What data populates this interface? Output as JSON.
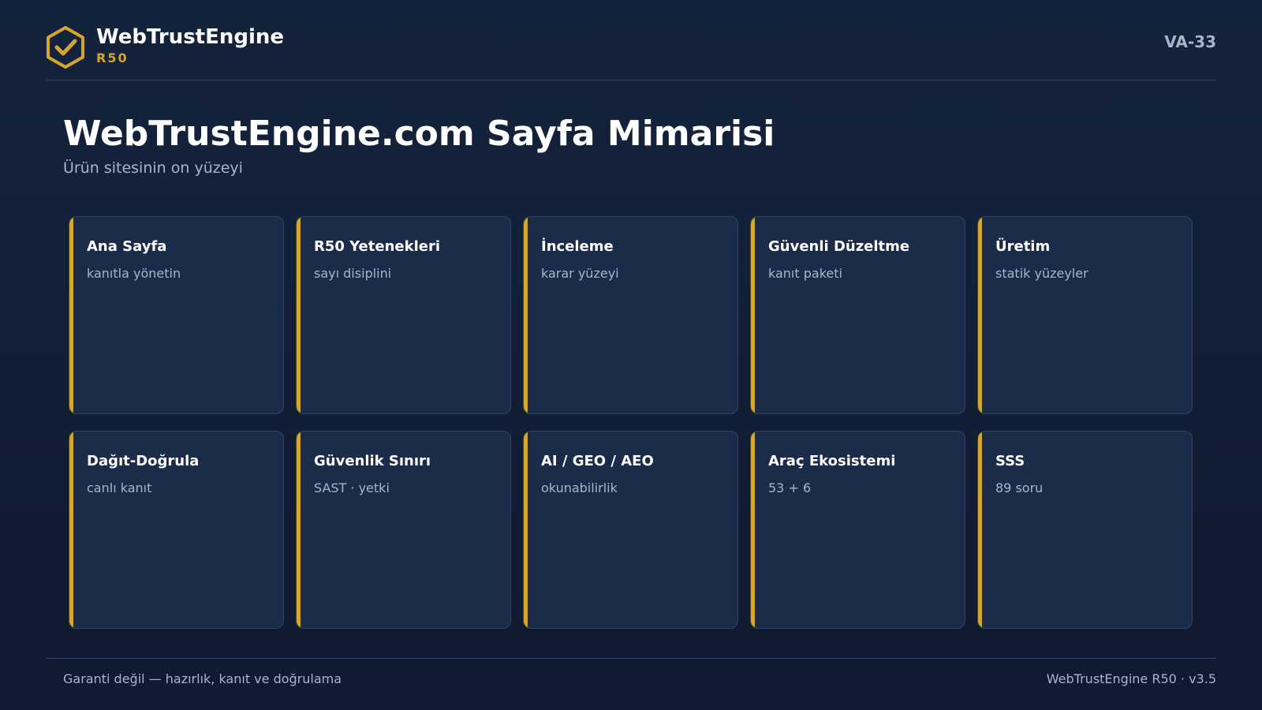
{
  "header": {
    "brand_name": "WebTrustEngine",
    "brand_sub": "R50",
    "doc_code": "VA-33",
    "logo_icon": "hexagon-check-icon",
    "accent_color": "#d4a72c"
  },
  "main": {
    "title": "WebTrustEngine.com Sayfa Mimarisi",
    "subtitle": "Ürün sitesinin on yüzeyi",
    "cards": [
      {
        "title": "Ana Sayfa",
        "desc": "kanıtla yönetin"
      },
      {
        "title": "R50 Yetenekleri",
        "desc": "sayı disiplini"
      },
      {
        "title": "İnceleme",
        "desc": "karar yüzeyi"
      },
      {
        "title": "Güvenli Düzeltme",
        "desc": "kanıt paketi"
      },
      {
        "title": "Üretim",
        "desc": "statik yüzeyler"
      },
      {
        "title": "Dağıt-Doğrula",
        "desc": "canlı kanıt"
      },
      {
        "title": "Güvenlik Sınırı",
        "desc": "SAST · yetki"
      },
      {
        "title": "AI / GEO / AEO",
        "desc": "okunabilirlik"
      },
      {
        "title": "Araç Ekosistemi",
        "desc": "53 + 6"
      },
      {
        "title": "SSS",
        "desc": "89 soru"
      }
    ]
  },
  "footer": {
    "left": "Garanti değil — hazırlık, kanıt ve doğrulama",
    "right": "WebTrustEngine R50 · v3.5"
  },
  "colors": {
    "background": "#13223b",
    "card": "#1b2c4a",
    "accent": "#d4a72c",
    "muted_text": "#aab4c6"
  }
}
